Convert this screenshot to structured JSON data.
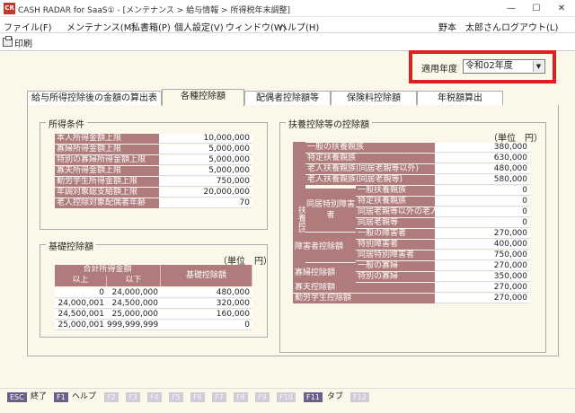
{
  "window": {
    "icon_text": "CR",
    "title": "CASH RADAR for SaaS① - [メンテナンス > 給与情報 > 所得税年末調整]",
    "minimize": "—",
    "restore": "☐",
    "close": "✕"
  },
  "menu": {
    "items": [
      "ファイル(F)",
      "メンテナンス(M)",
      "私書箱(P)",
      "個人設定(V)",
      "ウィンドウ(W)",
      "ヘルプ(H)"
    ],
    "user": "野本　太郎さん",
    "logout": "ログアウト(L)"
  },
  "toolbar": {
    "print": "印刷"
  },
  "year": {
    "label": "適用年度",
    "value": "令和02年度"
  },
  "tabs": [
    "給与所得控除後の金額の算出表",
    "各種控除額",
    "配偶者控除額等",
    "保険料控除額",
    "年税額算出"
  ],
  "active_tab": "各種控除額",
  "income_conditions": {
    "title": "所得条件",
    "rows": [
      {
        "label": "本人所得金額上限",
        "value": "10,000,000"
      },
      {
        "label": "寡婦所得金額上限",
        "value": "5,000,000"
      },
      {
        "label": "特別の寡婦所得金額上限",
        "value": "5,000,000"
      },
      {
        "label": "寡夫所得金額上限",
        "value": "5,000,000"
      },
      {
        "label": "勤労学生所得金額上限",
        "value": "750,000"
      },
      {
        "label": "年調対象総支給額上限",
        "value": "20,000,000"
      },
      {
        "label": "老人控除対象配偶者年齢",
        "value": "70"
      }
    ]
  },
  "basic_deduction": {
    "title": "基礎控除額",
    "unit": "（単位　円）",
    "header_total": "合計所得金額",
    "header_min": "以上",
    "header_max": "以下",
    "header_amount": "基礎控除額",
    "rows": [
      {
        "min": "0",
        "max": "24,000,000",
        "amount": "480,000"
      },
      {
        "min": "24,000,001",
        "max": "24,500,000",
        "amount": "320,000"
      },
      {
        "min": "24,500,001",
        "max": "25,000,000",
        "amount": "160,000"
      },
      {
        "min": "25,000,001",
        "max": "999,999,999",
        "amount": "0"
      }
    ]
  },
  "dependents": {
    "title": "扶養控除等の控除額",
    "unit": "（単位　円）",
    "side_label": "扶養控除額",
    "cohab_label": "同居特別障害者",
    "disabled_label": "障害者控除額",
    "widow_label": "寡婦控除額",
    "rows": [
      {
        "label": "一般の扶養親族",
        "value": "380,000"
      },
      {
        "label": "特定扶養親族",
        "value": "630,000"
      },
      {
        "label": "老人扶養親族(同居老親等以外)",
        "value": "480,000"
      },
      {
        "label": "老人扶養親族(同居老親等)",
        "value": "580,000"
      },
      {
        "label": "一般扶養親族",
        "value": "0"
      },
      {
        "label": "特定扶養親族",
        "value": "0"
      },
      {
        "label": "同居老親等以外の老人",
        "value": "0"
      },
      {
        "label": "同居老親等",
        "value": "0"
      },
      {
        "label": "一般の障害者",
        "value": "270,000"
      },
      {
        "label": "特別障害者",
        "value": "400,000"
      },
      {
        "label": "同居特別障害者",
        "value": "750,000"
      },
      {
        "label": "一般の寡婦",
        "value": "270,000"
      },
      {
        "label": "特別の寡婦",
        "value": "350,000"
      },
      {
        "label": "寡夫控除額",
        "value": "270,000"
      },
      {
        "label": "勤労学生控除額",
        "value": "270,000"
      }
    ]
  },
  "status": {
    "keys": [
      {
        "key": "ESC",
        "label": "終了"
      },
      {
        "key": "F1",
        "label": "ヘルプ"
      },
      {
        "key": "F2"
      },
      {
        "key": "F3"
      },
      {
        "key": "F4"
      },
      {
        "key": "F5"
      },
      {
        "key": "F6"
      },
      {
        "key": "F7"
      },
      {
        "key": "F8"
      },
      {
        "key": "F9"
      },
      {
        "key": "F10"
      },
      {
        "key": "F11",
        "label": "タブ"
      },
      {
        "key": "F12"
      }
    ]
  },
  "colors": {
    "label_bg": "#b07b7b",
    "highlight_border": "#e02020",
    "page_bg": "#fbf8e9"
  }
}
